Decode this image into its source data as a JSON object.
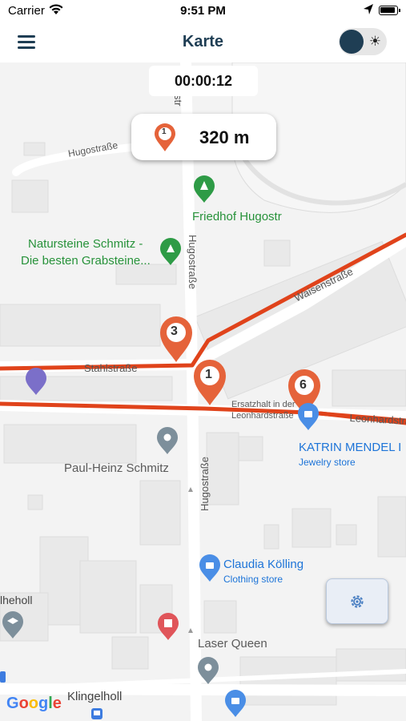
{
  "status_bar": {
    "carrier": "Carrier",
    "time": "9:51 PM"
  },
  "header": {
    "title": "Karte",
    "dark_mode_enabled": true
  },
  "timer": {
    "value": "00:00:12"
  },
  "distance_card": {
    "marker_number": "1",
    "distance": "320 m"
  },
  "map": {
    "streets": [
      "Hugostraße",
      "Hugostraße",
      "Hugostraße",
      "Stahlstraße",
      "Waisenstraße",
      "Leonhardstraße",
      "Klingelholl",
      "lheholl",
      "str"
    ],
    "pois": {
      "friedhof": "Friedhof Hugostr",
      "natursteine_line1": "Natursteine Schmitz -",
      "natursteine_line2": "Die besten Grabsteine...",
      "ersatzhalt_line1": "Ersatzhalt in der",
      "ersatzhalt_line2": "Leonhardstraße",
      "katrin_name": "KATRIN MENDEL I",
      "katrin_type": "Jewelry store",
      "paul": "Paul-Heinz Schmitz",
      "claudia_name": "Claudia Kölling",
      "claudia_type": "Clothing store",
      "laser": "Laser Queen"
    },
    "markers": [
      "1",
      "3",
      "6"
    ],
    "route_color": "#e0431b",
    "marker_color": "#e5633a"
  },
  "settings_button": {
    "icon": "gear-icon"
  },
  "attribution": {
    "g1": "G",
    "g2": "o",
    "g3": "o",
    "g4": "g",
    "g5": "l",
    "g6": "e"
  }
}
